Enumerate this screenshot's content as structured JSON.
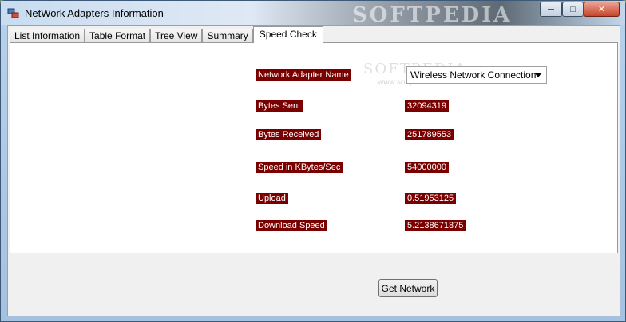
{
  "window": {
    "title": "NetWork Adapters Information",
    "watermark": "SOFTPEDIA",
    "controls": {
      "minimize": "─",
      "maximize": "□",
      "close": "✕"
    }
  },
  "tabs": [
    {
      "label": "List Information",
      "active": false
    },
    {
      "label": "Table Format",
      "active": false
    },
    {
      "label": "Tree View",
      "active": false
    },
    {
      "label": "Summary",
      "active": false
    },
    {
      "label": "Speed Check",
      "active": true
    }
  ],
  "speed_check": {
    "watermark": "SOFTPEDIA",
    "watermark_url": "www.softpedia.com",
    "adapter_label": "Network Adapter Name",
    "adapter_selected": "Wireless Network Connection",
    "fields": [
      {
        "label": "Bytes Sent",
        "value": "32094319"
      },
      {
        "label": "Bytes Received",
        "value": "251789553"
      },
      {
        "label": "Speed in KBytes/Sec",
        "value": "54000000"
      },
      {
        "label": "Upload",
        "value": "0.51953125"
      },
      {
        "label": "Download Speed",
        "value": "5.2138671875"
      }
    ]
  },
  "get_network_button": "Get Network",
  "colors": {
    "label_bg": "#7a0000",
    "label_fg": "#ffffff"
  },
  "icons": [
    "app-icon",
    "minimize-icon",
    "maximize-icon",
    "close-icon",
    "dropdown-arrow-icon"
  ]
}
